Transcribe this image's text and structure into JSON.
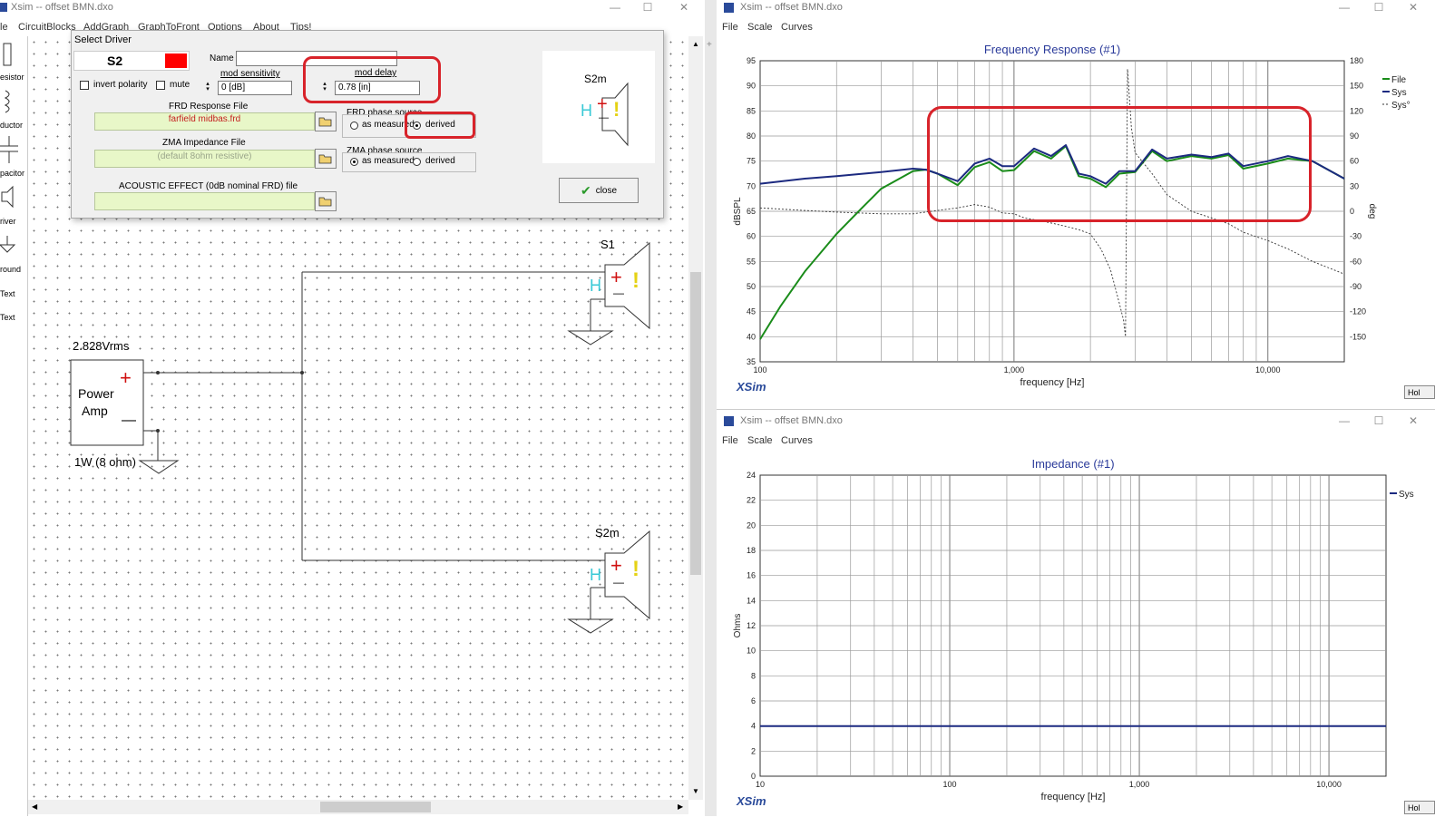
{
  "left_window": {
    "title": "Xsim -- offset BMN.dxo",
    "menu": [
      "le",
      "CircuitBlocks",
      "AddGraph",
      "GraphToFront",
      "Options",
      "About",
      "Tips!"
    ],
    "palette": [
      "esistor",
      "ductor",
      "pacitor",
      "river",
      "round",
      "Text",
      "Text"
    ],
    "circuit": {
      "amp_voltage": "2.828Vrms",
      "amp_line1": "Power",
      "amp_line2": "Amp",
      "amp_plus": "+",
      "amp_minus": "—",
      "amp_power": "1W (8 ohm)",
      "driver1_label": "S1",
      "driver2_label": "S2m",
      "driver_plus": "+",
      "driver_minus": "—",
      "driver_h": "H",
      "driver_bang": "!"
    }
  },
  "dialog": {
    "title": "Select Driver",
    "driver_id": "S2",
    "driver_color": "#ff0000",
    "name_label": "Name",
    "name_value": "",
    "invert_label": "invert polarity",
    "mute_label": "mute",
    "mod_sensitivity_label": "mod sensitivity",
    "mod_sensitivity_value": "0 [dB]",
    "mod_delay_label": "mod delay",
    "mod_delay_value": "0.78 [in]",
    "frd_label": "FRD Response File",
    "frd_value": "farfield midbas.frd",
    "frd_phase_label": "FRD phase source",
    "frd_as_measured": "as measured",
    "frd_derived": "derived",
    "zma_label": "ZMA Impedance File",
    "zma_value": "(default 8ohm resistive)",
    "zma_phase_label": "ZMA phase source",
    "zma_as_measured": "as measured",
    "zma_derived": "derived",
    "acoustic_label": "ACOUSTIC EFFECT (0dB nominal FRD) file",
    "acoustic_value": "",
    "close_label": "close",
    "preview_label": "S2m"
  },
  "freq_window": {
    "title": "Xsim -- offset BMN.dxo",
    "menu": [
      "File",
      "Scale",
      "Curves"
    ],
    "brand": "XSim",
    "hold": "Hol"
  },
  "imp_window": {
    "title": "Xsim -- offset BMN.dxo",
    "menu": [
      "File",
      "Scale",
      "Curves"
    ],
    "brand": "XSim",
    "hold": "Hol"
  },
  "chart_data": [
    {
      "type": "line",
      "title": "Frequency Response (#1)",
      "xlabel": "frequency [Hz]",
      "ylabel": "dBSPL",
      "y2label": "deg",
      "xscale": "log",
      "xlim": [
        100,
        20000
      ],
      "ylim": [
        35,
        95
      ],
      "y2lim": [
        -180,
        180
      ],
      "xticks": [
        100,
        1000,
        10000
      ],
      "xticklabels": [
        "100",
        "1,000",
        "10,000"
      ],
      "yticks": [
        35,
        40,
        45,
        50,
        55,
        60,
        65,
        70,
        75,
        80,
        85,
        90,
        95
      ],
      "y2ticks": [
        -150,
        -120,
        -90,
        -60,
        -30,
        0,
        30,
        60,
        90,
        120,
        150,
        180
      ],
      "grid": true,
      "legend": "top-right",
      "legend_entries": [
        "File",
        "Sys",
        "Sys°"
      ],
      "series": [
        {
          "name": "File",
          "color": "#1a8c1a",
          "x": [
            100,
            120,
            150,
            200,
            250,
            300,
            400,
            450,
            500,
            600,
            700,
            800,
            900,
            1000,
            1200,
            1400,
            1600,
            1800,
            2000,
            2300,
            2600,
            3000,
            3500,
            4000,
            5000,
            6000,
            7000,
            8000,
            10000,
            12000,
            15000,
            20000
          ],
          "y": [
            39.5,
            46,
            53,
            60.5,
            65.5,
            69.5,
            73,
            73.3,
            72.5,
            70.2,
            73.8,
            74.8,
            73,
            73.2,
            77,
            75.5,
            78,
            72,
            71.5,
            69.8,
            72.5,
            72.8,
            77,
            75,
            76,
            75.5,
            76.2,
            73.5,
            74.5,
            75.5,
            75,
            71.5
          ]
        },
        {
          "name": "Sys",
          "color": "#1c2a80",
          "x": [
            100,
            150,
            200,
            300,
            400,
            450,
            500,
            600,
            700,
            800,
            900,
            1000,
            1200,
            1400,
            1600,
            1800,
            2000,
            2300,
            2600,
            3000,
            3500,
            4000,
            5000,
            6000,
            7000,
            8000,
            10000,
            12000,
            15000,
            20000
          ],
          "y": [
            70.5,
            71.5,
            72,
            72.8,
            73.5,
            73.3,
            72.5,
            71,
            74.5,
            75.5,
            74,
            74,
            77.5,
            76,
            78.2,
            72.5,
            72,
            70.5,
            73,
            73,
            77.3,
            75.5,
            76.3,
            75.8,
            76.5,
            74,
            75,
            76,
            75,
            71.5
          ]
        },
        {
          "name": "Sys°",
          "color": "#333333",
          "dashed": true,
          "axis": "right",
          "x": [
            100,
            150,
            200,
            300,
            400,
            500,
            600,
            700,
            800,
            900,
            1000,
            1100,
            1200,
            1400,
            1600,
            1800,
            2000,
            2200,
            2400,
            2600,
            2700,
            2750,
            2800,
            2900,
            3000,
            3500,
            4000,
            5000,
            6000,
            7000,
            8000,
            10000,
            12000,
            15000,
            20000
          ],
          "y": [
            4,
            1,
            -1,
            -3,
            -3,
            1,
            4,
            8,
            5,
            -2,
            -3,
            -8,
            -10,
            -14,
            -18,
            -22,
            -27,
            -45,
            -70,
            -110,
            -130,
            -150,
            170,
            100,
            70,
            45,
            20,
            0,
            -8,
            -15,
            -25,
            -35,
            -45,
            -60,
            -75
          ]
        }
      ]
    },
    {
      "type": "line",
      "title": "Impedance (#1)",
      "xlabel": "frequency [Hz]",
      "ylabel": "Ohms",
      "xscale": "log",
      "xlim": [
        10,
        20000
      ],
      "ylim": [
        0,
        24
      ],
      "xticks": [
        10,
        100,
        1000,
        10000
      ],
      "xticklabels": [
        "10",
        "100",
        "1,000",
        "10,000"
      ],
      "yticks": [
        0,
        2,
        4,
        6,
        8,
        10,
        12,
        14,
        16,
        18,
        20,
        22,
        24
      ],
      "grid": true,
      "legend": "top-right",
      "legend_entries": [
        "Sys"
      ],
      "series": [
        {
          "name": "Sys",
          "color": "#1c2a80",
          "x": [
            10,
            20000
          ],
          "y": [
            4,
            4
          ]
        }
      ]
    }
  ]
}
